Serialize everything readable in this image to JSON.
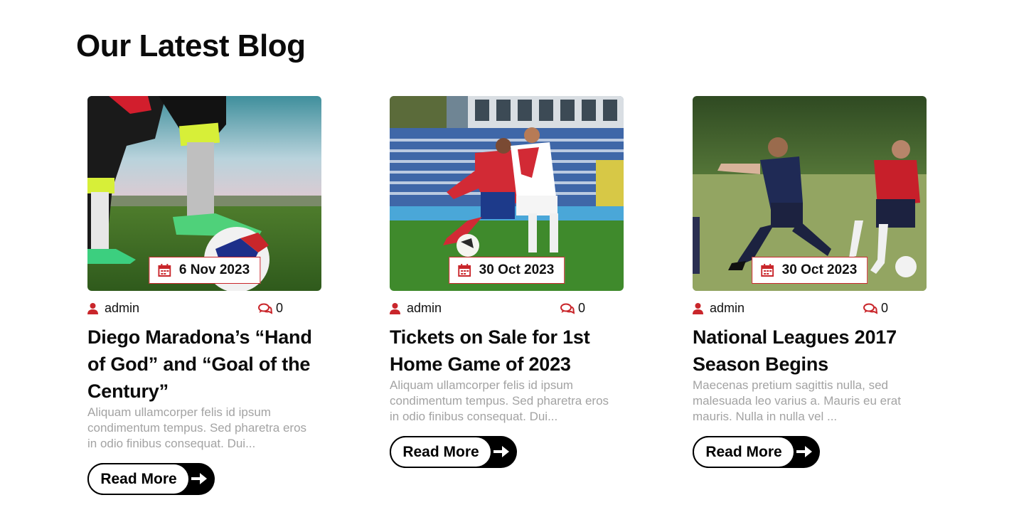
{
  "section": {
    "title": "Our Latest Blog"
  },
  "accent_color": "#c9262b",
  "posts": [
    {
      "date": "6 Nov 2023",
      "author": "admin",
      "comments": "0",
      "title": "Diego Maradona’s “Hand of God” and “Goal of the Century”",
      "excerpt": "Aliquam ullamcorper felis id ipsum condimentum tempus. Sed pharetra eros in odio finibus consequat. Dui...",
      "read_more": "Read More",
      "image": "soccer-player-foot-on-ball"
    },
    {
      "date": "30 Oct 2023",
      "author": "admin",
      "comments": "0",
      "title": "Tickets on Sale for 1st Home Game of 2023",
      "excerpt": "Aliquam ullamcorper felis id ipsum condimentum tempus. Sed pharetra eros in odio finibus consequat. Dui...",
      "read_more": "Read More",
      "image": "women-soccer-match-stadium"
    },
    {
      "date": "30 Oct 2023",
      "author": "admin",
      "comments": "0",
      "title": "National Leagues 2017 Season Begins",
      "excerpt": "Maecenas pretium sagittis nulla, sed malesuada leo varius a. Mauris eu erat mauris. Nulla in nulla vel ...",
      "read_more": "Read More",
      "image": "youth-soccer-players-tackle"
    }
  ]
}
